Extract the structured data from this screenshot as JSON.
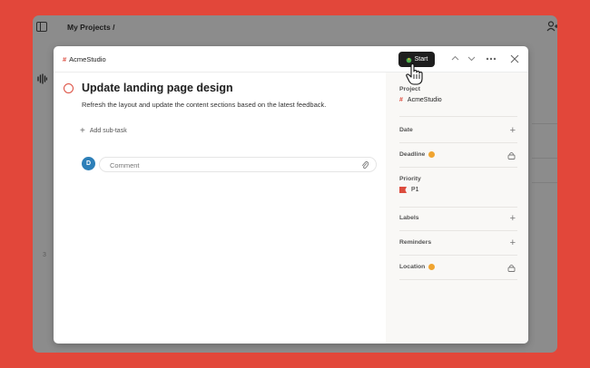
{
  "app": {
    "breadcrumb": "My Projects /",
    "side_number": "3"
  },
  "modal": {
    "project_breadcrumb": "AcmeStudio",
    "start_label": "Start",
    "task": {
      "title": "Update landing page design",
      "description": "Refresh the layout and update the content sections based on the latest feedback."
    },
    "add_subtask_label": "Add sub-task",
    "comment": {
      "avatar_initial": "D",
      "placeholder": "Comment"
    },
    "sidebar": {
      "project_label": "Project",
      "project_value": "AcmeStudio",
      "date_label": "Date",
      "deadline_label": "Deadline",
      "priority_label": "Priority",
      "priority_value": "P1",
      "labels_label": "Labels",
      "reminders_label": "Reminders",
      "location_label": "Location"
    }
  },
  "colors": {
    "background": "#e2473a",
    "accent": "#dc4c3e",
    "avatar": "#2d7fb8",
    "upgrade_badge": "#f0a430"
  }
}
